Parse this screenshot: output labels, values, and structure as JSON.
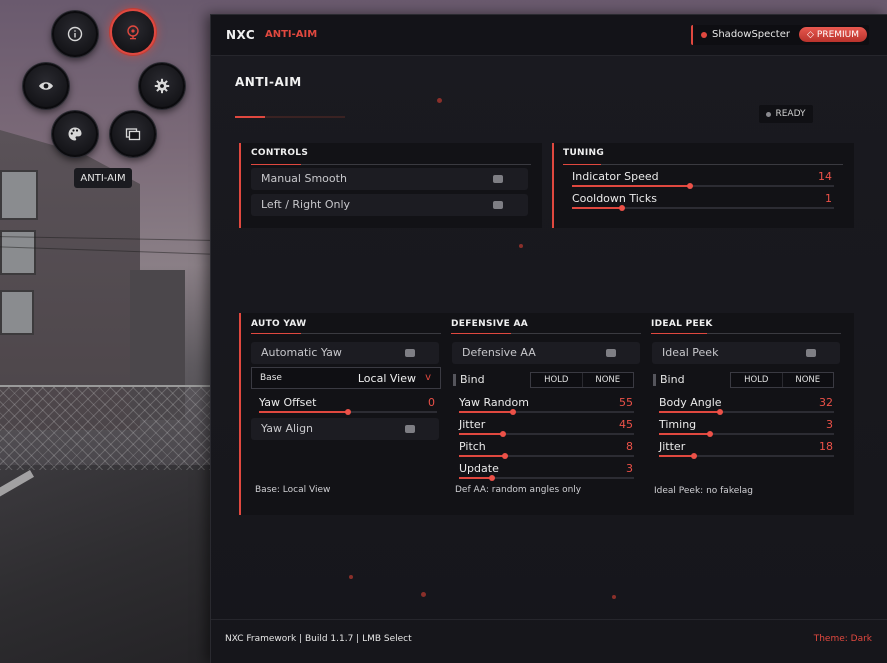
{
  "nav": {
    "tooltip": "ANTI-AIM",
    "buttons": [
      {
        "icon": "info-icon"
      },
      {
        "icon": "crosshair-icon",
        "active": true
      },
      {
        "icon": "eye-icon"
      },
      {
        "icon": "gear-icon"
      },
      {
        "icon": "palette-icon"
      },
      {
        "icon": "folder-icon"
      }
    ]
  },
  "header": {
    "brand": "NXC",
    "subtitle": "ANTI-AIM",
    "username": "ShadowSpecter",
    "badge": "PREMIUM"
  },
  "page": {
    "title": "ANTI-AIM",
    "status": "READY"
  },
  "controls": {
    "title": "CONTROLS",
    "toggles": [
      {
        "label": "Manual Smooth",
        "on": false
      },
      {
        "label": "Left / Right Only",
        "on": false
      }
    ]
  },
  "tuning": {
    "title": "TUNING",
    "sliders": [
      {
        "label": "Indicator Speed",
        "value": "14",
        "fill": 0.45
      },
      {
        "label": "Cooldown Ticks",
        "value": "1",
        "fill": 0.19
      }
    ]
  },
  "auto_yaw": {
    "title": "AUTO YAW",
    "toggle": {
      "label": "Automatic Yaw",
      "on": false
    },
    "combo": {
      "label": "Base",
      "value": "Local View",
      "arrow": "v"
    },
    "slider": {
      "label": "Yaw Offset",
      "value": "0",
      "fill": 0.5
    },
    "toggle2": {
      "label": "Yaw Align",
      "on": false
    },
    "note": "Base: Local View"
  },
  "defensive": {
    "title": "DEFENSIVE AA",
    "toggle": {
      "label": "Defensive AA",
      "on": false
    },
    "bind": {
      "label": "Bind",
      "mode": "HOLD",
      "key": "NONE"
    },
    "sliders": [
      {
        "label": "Yaw Random",
        "value": "55",
        "fill": 0.31
      },
      {
        "label": "Jitter",
        "value": "45",
        "fill": 0.25
      },
      {
        "label": "Pitch",
        "value": "8",
        "fill": 0.26
      },
      {
        "label": "Update",
        "value": "3",
        "fill": 0.19
      }
    ],
    "note": "Def AA: random angles only"
  },
  "ideal_peek": {
    "title": "IDEAL PEEK",
    "toggle": {
      "label": "Ideal Peek",
      "on": false
    },
    "bind": {
      "label": "Bind",
      "mode": "HOLD",
      "key": "NONE"
    },
    "sliders": [
      {
        "label": "Body Angle",
        "value": "32",
        "fill": 0.35
      },
      {
        "label": "Timing",
        "value": "3",
        "fill": 0.29
      },
      {
        "label": "Jitter",
        "value": "18",
        "fill": 0.2
      }
    ],
    "note": "Ideal Peek: no fakelag"
  },
  "footer": {
    "left": "NXC Framework | Build 1.1.7 | LMB Select",
    "right": "Theme: Dark"
  },
  "colors": {
    "accent": "#e0483f",
    "panel": "#16161b"
  }
}
